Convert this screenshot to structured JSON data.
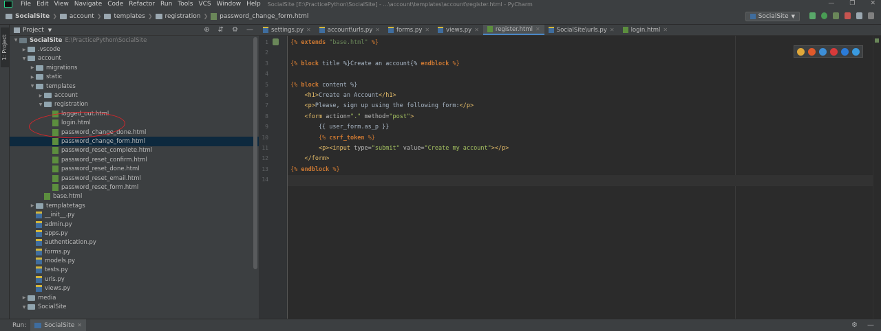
{
  "menubar": {
    "items": [
      "File",
      "Edit",
      "View",
      "Navigate",
      "Code",
      "Refactor",
      "Run",
      "Tools",
      "VCS",
      "Window",
      "Help"
    ],
    "title": "SocialSite [E:\\PracticePython\\SocialSite] - ...\\account\\templates\\account\\register.html - PyCharm"
  },
  "navbar": {
    "crumbs": [
      "SocialSite",
      "account",
      "templates",
      "registration"
    ],
    "file": "password_change_form.html",
    "run_config": "SocialSite"
  },
  "sidestrip": {
    "project_tab": "1: Project"
  },
  "project_panel": {
    "title": "Project",
    "root_name": "SocialSite",
    "root_path": "E:\\PracticePython\\SocialSite",
    "tree": [
      {
        "label": ".vscode",
        "kind": "folder",
        "level": 1,
        "expanded": false
      },
      {
        "label": "account",
        "kind": "folder",
        "level": 1,
        "expanded": true
      },
      {
        "label": "migrations",
        "kind": "folder",
        "level": 2,
        "expanded": false
      },
      {
        "label": "static",
        "kind": "folder",
        "level": 2,
        "expanded": false
      },
      {
        "label": "templates",
        "kind": "folder",
        "level": 2,
        "expanded": true
      },
      {
        "label": "account",
        "kind": "folder",
        "level": 3,
        "expanded": false
      },
      {
        "label": "registration",
        "kind": "folder",
        "level": 3,
        "expanded": true
      },
      {
        "label": "logged_out.html",
        "kind": "html",
        "level": 4
      },
      {
        "label": "login.html",
        "kind": "html",
        "level": 4
      },
      {
        "label": "password_change_done.html",
        "kind": "html",
        "level": 4
      },
      {
        "label": "password_change_form.html",
        "kind": "html",
        "level": 4,
        "selected": true
      },
      {
        "label": "password_reset_complete.html",
        "kind": "html",
        "level": 4
      },
      {
        "label": "password_reset_confirm.html",
        "kind": "html",
        "level": 4
      },
      {
        "label": "password_reset_done.html",
        "kind": "html",
        "level": 4
      },
      {
        "label": "password_reset_email.html",
        "kind": "html",
        "level": 4
      },
      {
        "label": "password_reset_form.html",
        "kind": "html",
        "level": 4
      },
      {
        "label": "base.html",
        "kind": "html",
        "level": 3
      },
      {
        "label": "templatetags",
        "kind": "folder",
        "level": 2,
        "expanded": false
      },
      {
        "label": "__init__.py",
        "kind": "py",
        "level": 2
      },
      {
        "label": "admin.py",
        "kind": "py",
        "level": 2
      },
      {
        "label": "apps.py",
        "kind": "py",
        "level": 2
      },
      {
        "label": "authentication.py",
        "kind": "py",
        "level": 2
      },
      {
        "label": "forms.py",
        "kind": "py",
        "level": 2
      },
      {
        "label": "models.py",
        "kind": "py",
        "level": 2
      },
      {
        "label": "tests.py",
        "kind": "py",
        "level": 2
      },
      {
        "label": "urls.py",
        "kind": "py",
        "level": 2
      },
      {
        "label": "views.py",
        "kind": "py",
        "level": 2
      },
      {
        "label": "media",
        "kind": "folder",
        "level": 1,
        "expanded": false
      },
      {
        "label": "SocialSite",
        "kind": "folder",
        "level": 1,
        "expanded": true
      }
    ]
  },
  "editor": {
    "tabs": [
      {
        "label": "settings.py",
        "kind": "py"
      },
      {
        "label": "account\\urls.py",
        "kind": "py"
      },
      {
        "label": "forms.py",
        "kind": "py"
      },
      {
        "label": "views.py",
        "kind": "py"
      },
      {
        "label": "register.html",
        "kind": "html",
        "active": true
      },
      {
        "label": "SocialSite\\urls.py",
        "kind": "py"
      },
      {
        "label": "login.html",
        "kind": "html"
      }
    ],
    "current_line": 14,
    "lines": [
      [
        {
          "t": "{% ",
          "c": "tpl"
        },
        {
          "t": "extends ",
          "c": "kw"
        },
        {
          "t": "\"base.html\"",
          "c": "str"
        },
        {
          "t": " %}",
          "c": "tpl"
        }
      ],
      [],
      [
        {
          "t": "{% ",
          "c": "tpl"
        },
        {
          "t": "block ",
          "c": "kw"
        },
        {
          "t": "title %}Create an account{% ",
          "c": ""
        },
        {
          "t": "endblock",
          "c": "kw"
        },
        {
          "t": " %}",
          "c": "tpl"
        }
      ],
      [],
      [
        {
          "t": "{% ",
          "c": "tpl"
        },
        {
          "t": "block ",
          "c": "kw"
        },
        {
          "t": "content %}",
          "c": ""
        }
      ],
      [
        {
          "t": "    ",
          "c": ""
        },
        {
          "t": "<h1>",
          "c": "tag"
        },
        {
          "t": "Create an Account",
          "c": ""
        },
        {
          "t": "</h1>",
          "c": "tag"
        }
      ],
      [
        {
          "t": "    ",
          "c": ""
        },
        {
          "t": "<p>",
          "c": "tag"
        },
        {
          "t": "Please, sign up using the following form:",
          "c": ""
        },
        {
          "t": "</p>",
          "c": "tag"
        }
      ],
      [
        {
          "t": "    ",
          "c": ""
        },
        {
          "t": "<form ",
          "c": "tag"
        },
        {
          "t": "action=",
          "c": "attr"
        },
        {
          "t": "\".\"",
          "c": "aval"
        },
        {
          "t": " method=",
          "c": "attr"
        },
        {
          "t": "\"post\"",
          "c": "aval"
        },
        {
          "t": ">",
          "c": "tag"
        }
      ],
      [
        {
          "t": "        {{ user_form.as_p }}",
          "c": ""
        }
      ],
      [
        {
          "t": "        ",
          "c": ""
        },
        {
          "t": "{% ",
          "c": "tpl"
        },
        {
          "t": "csrf_token",
          "c": "kw"
        },
        {
          "t": " %}",
          "c": "tpl"
        }
      ],
      [
        {
          "t": "        ",
          "c": ""
        },
        {
          "t": "<p><input ",
          "c": "tag"
        },
        {
          "t": "type=",
          "c": "attr"
        },
        {
          "t": "\"submit\"",
          "c": "aval"
        },
        {
          "t": " value=",
          "c": "attr"
        },
        {
          "t": "\"Create my account\"",
          "c": "aval"
        },
        {
          "t": "></p>",
          "c": "tag"
        }
      ],
      [
        {
          "t": "    ",
          "c": ""
        },
        {
          "t": "</form>",
          "c": "tag"
        }
      ],
      [
        {
          "t": "{% ",
          "c": "tpl"
        },
        {
          "t": "endblock",
          "c": "kw"
        },
        {
          "t": " %}",
          "c": "tpl"
        }
      ],
      []
    ],
    "browser_colors": [
      "#e0a83a",
      "#e05a2b",
      "#3d8fd8",
      "#d83a3a",
      "#2b7bd8",
      "#3a9ae0"
    ]
  },
  "bottombar": {
    "run_label": "Run:",
    "run_tab": "SocialSite"
  }
}
